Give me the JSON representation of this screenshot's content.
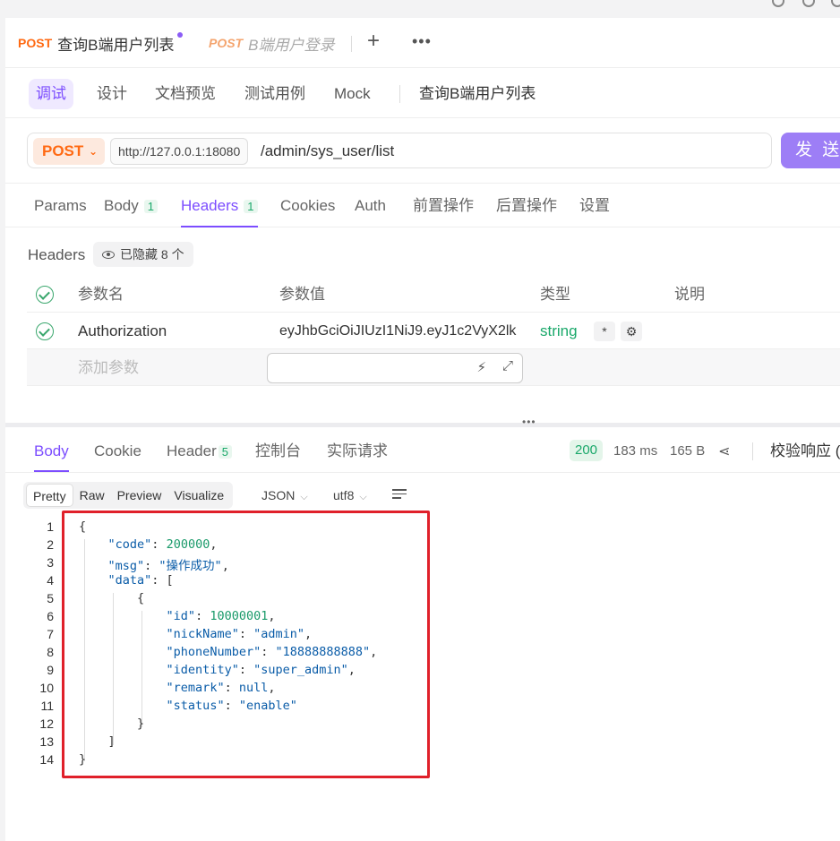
{
  "tabs": [
    {
      "method": "POST",
      "name": "查询B端用户列表",
      "active": true
    },
    {
      "method": "POST",
      "name": "B端用户登录",
      "active": false
    }
  ],
  "subnav": {
    "items": [
      "调试",
      "设计",
      "文档预览",
      "测试用例",
      "Mock"
    ],
    "title": "查询B端用户列表"
  },
  "request": {
    "method": "POST",
    "base_url": "http://127.0.0.1:18080",
    "path": "/admin/sys_user/list",
    "send_label": "发 送"
  },
  "request_tabs": [
    {
      "label": "Params"
    },
    {
      "label": "Body",
      "count": "1"
    },
    {
      "label": "Headers",
      "count": "1"
    },
    {
      "label": "Cookies"
    },
    {
      "label": "Auth"
    },
    {
      "label": "前置操作"
    },
    {
      "label": "后置操作"
    },
    {
      "label": "设置"
    }
  ],
  "headers_section": {
    "label": "Headers",
    "hidden_label": "已隐藏 8 个",
    "columns": [
      "参数名",
      "参数值",
      "类型",
      "说明"
    ],
    "rows": [
      {
        "name": "Authorization",
        "value": "eyJhbGciOiJIUzI1NiJ9.eyJ1c2VyX2lk",
        "type": "string",
        "required_mark": "*"
      }
    ],
    "add_placeholder": "添加参数"
  },
  "response_tabs": [
    {
      "label": "Body"
    },
    {
      "label": "Cookie"
    },
    {
      "label": "Header",
      "count": "5"
    },
    {
      "label": "控制台"
    },
    {
      "label": "实际请求"
    }
  ],
  "response_meta": {
    "status": "200",
    "time": "183 ms",
    "size": "165 B",
    "validate_label": "校验响应"
  },
  "view_modes": [
    "Pretty",
    "Raw",
    "Preview",
    "Visualize"
  ],
  "format": "JSON",
  "encoding": "utf8",
  "code_lines": [
    "1",
    "2",
    "3",
    "4",
    "5",
    "6",
    "7",
    "8",
    "9",
    "10",
    "11",
    "12",
    "13",
    "14"
  ],
  "response_body": {
    "code": "200000",
    "msg": "\"操作成功\"",
    "id": "10000001",
    "nickName": "\"admin\"",
    "phoneNumber": "\"18888888888\"",
    "identity": "\"super_admin\"",
    "remark": "null",
    "status": "\"enable\""
  },
  "colors": {
    "accent": "#7c4dff",
    "method": "#ff6a13",
    "send_button": "#9d7ef6",
    "success": "#1aa86a",
    "highlight_box": "#e0202a"
  }
}
